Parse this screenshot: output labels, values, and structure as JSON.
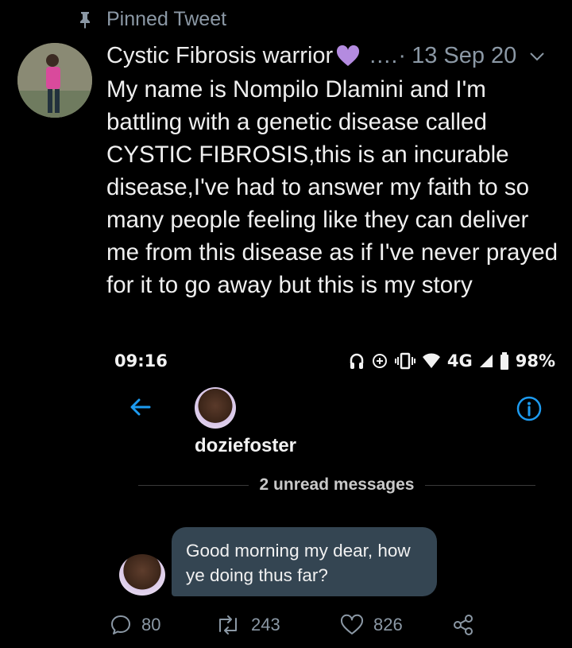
{
  "pinned": {
    "label": "Pinned Tweet",
    "icon": "pin-icon"
  },
  "tweet": {
    "author": "Cystic Fibrosis warrior",
    "author_emoji": "purple-heart-icon",
    "more_dots": "....·",
    "date": "13 Sep 20",
    "text": "My name is Nompilo Dlamini and I'm battling with a genetic disease called CYSTIC FIBROSIS,this is an incurable disease,I've had to answer my faith to so many people feeling like they can deliver me from this disease as if I've never prayed for it to go away but this is my story"
  },
  "embedded_screenshot": {
    "status_bar": {
      "time": "09:16",
      "network": "4G",
      "battery": "98%",
      "icons": [
        "headphones-icon",
        "data-saver-icon",
        "vibrate-icon",
        "wifi-icon",
        "signal-icon",
        "battery-icon"
      ]
    },
    "dm": {
      "username": "doziefoster",
      "unread": "2 unread messages",
      "message": "Good morning my dear, how ye doing thus far?"
    },
    "colors": {
      "accent": "#1d9bf0",
      "bubble": "#344552"
    }
  },
  "actions": {
    "reply_count": "80",
    "retweet_count": "243",
    "like_count": "826"
  },
  "colors": {
    "background": "#000000",
    "muted": "#8b98a5",
    "heart": "#b48be0"
  }
}
